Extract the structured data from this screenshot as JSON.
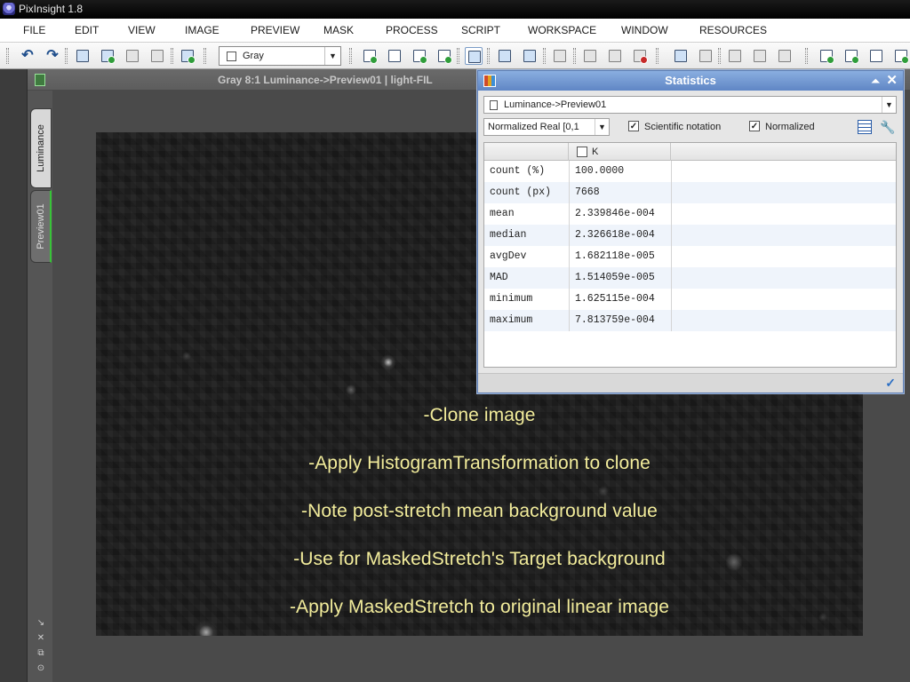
{
  "app": {
    "title": "PixInsight 1.8"
  },
  "menu": [
    "FILE",
    "EDIT",
    "VIEW",
    "IMAGE",
    "PREVIEW",
    "MASK",
    "PROCESS",
    "SCRIPT",
    "WORKSPACE",
    "WINDOW",
    "RESOURCES"
  ],
  "toolbar": {
    "channel_value": "Gray"
  },
  "image_window": {
    "title": "Gray 8:1 Luminance->Preview01 | light-FIL",
    "tabs": [
      "Luminance",
      "Preview01"
    ]
  },
  "statistics": {
    "title": "Statistics",
    "view": "Luminance->Preview01",
    "range": "Normalized Real [0,1",
    "scientific_notation": {
      "label": "Scientific notation",
      "checked": true
    },
    "normalized": {
      "label": "Normalized",
      "checked": true
    },
    "column": "K",
    "rows": [
      {
        "key": "count (%)",
        "value": "100.0000"
      },
      {
        "key": "count (px)",
        "value": "7668"
      },
      {
        "key": "mean",
        "value": "2.339846e-004"
      },
      {
        "key": "median",
        "value": "2.326618e-004"
      },
      {
        "key": "avgDev",
        "value": "1.682118e-005"
      },
      {
        "key": "MAD",
        "value": "1.514059e-005"
      },
      {
        "key": "minimum",
        "value": "1.625115e-004"
      },
      {
        "key": "maximum",
        "value": "7.813759e-004"
      }
    ]
  },
  "notes": [
    "-Clone image",
    "-Apply HistogramTransformation to clone",
    "-Note post-stretch mean background value",
    "-Use for MaskedStretch's Target background",
    "-Apply MaskedStretch to original linear image"
  ]
}
